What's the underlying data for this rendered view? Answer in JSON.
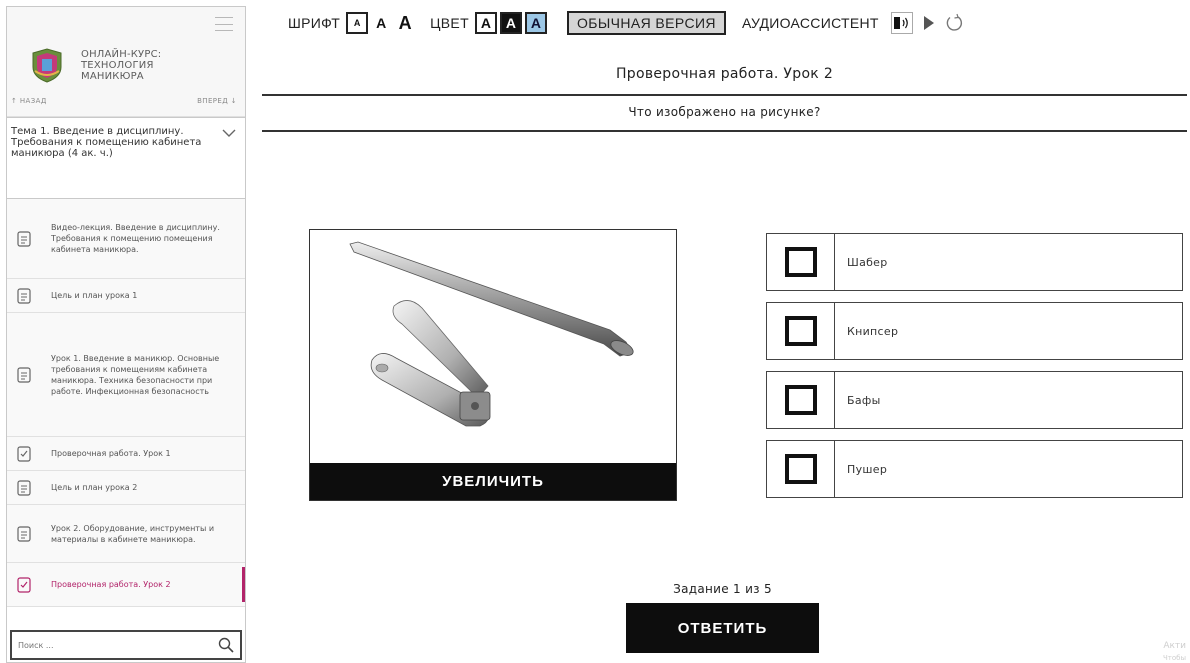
{
  "sidebar": {
    "course_title": [
      "ОНЛАЙН-КУРС:",
      "ТЕХНОЛОГИЯ",
      "МАНИКЮРА"
    ],
    "nav_back": "↑ НАЗАД",
    "nav_forward": "ВПЕРЕД ↓",
    "topic_title": "Тема 1. Введение в дисциплину. Требования к помещению кабинета маникюра (4 ак. ч.)",
    "lessons": [
      {
        "label": "Видео-лекция. Введение в дисциплину. Требования к помещению помещения кабинета маникюра.",
        "icon": "document-icon",
        "active": false
      },
      {
        "label": "Цель и план урока 1",
        "icon": "document-icon",
        "active": false
      },
      {
        "label": "Урок 1. Введение в маникюр. Основные требования к помещениям кабинета маникюра. Техника безопасности при работе. Инфекционная безопасность",
        "icon": "document-icon",
        "active": false
      },
      {
        "label": "Проверочная работа. Урок 1",
        "icon": "test-icon",
        "active": false
      },
      {
        "label": "Цель и план урока 2",
        "icon": "document-icon",
        "active": false
      },
      {
        "label": "Урок 2. Оборудование, инструменты и материалы в кабинете маникюра.",
        "icon": "document-icon",
        "active": false
      },
      {
        "label": "Проверочная работа. Урок 2",
        "icon": "test-icon",
        "active": true
      }
    ],
    "search_placeholder": "Поиск ..."
  },
  "toolbar": {
    "font_label": "ШРИФТ",
    "font_sizes": [
      "A",
      "A",
      "A"
    ],
    "color_label": "ЦВЕТ",
    "color_letters": [
      "A",
      "A",
      "A"
    ],
    "normal_version": "ОБЫЧНАЯ ВЕРСИЯ",
    "audio_label": "АУДИОАССИСТЕНТ"
  },
  "main": {
    "title": "Проверочная работа. Урок 2",
    "question": "Что изображено на рисунке?",
    "zoom_button": "УВЕЛИЧИТЬ",
    "options": [
      "Шабер",
      "Книпсер",
      "Бафы",
      "Пушер"
    ],
    "task_counter": "Задание 1 из 5",
    "answer_button": "ОТВЕТИТЬ"
  },
  "watermark": [
    "Акти",
    "Чтобы"
  ],
  "colors": {
    "accent": "#b2246a",
    "dark_button": "#0d0d0d",
    "blue_scheme": "#9cc7e6"
  }
}
